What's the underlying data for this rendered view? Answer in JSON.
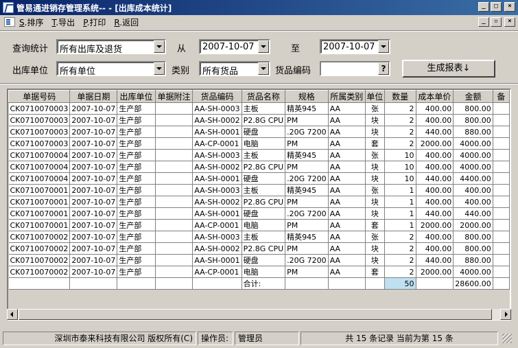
{
  "window": {
    "title": "管易通进销存管理系统-- - [出库成本统计]"
  },
  "menu": [
    {
      "key": "S",
      "label": ".排序"
    },
    {
      "key": "T",
      "label": ".导出"
    },
    {
      "key": "P",
      "label": ".打印"
    },
    {
      "key": "R",
      "label": ".返回"
    }
  ],
  "filters": {
    "query_label": "查询统计",
    "query_value": "所有出库及退货",
    "from_label": "从",
    "from_value": "2007-10-07",
    "to_label": "至",
    "to_value": "2007-10-07",
    "dept_label": "出库单位",
    "dept_value": "所有单位",
    "category_label": "类别",
    "category_value": "所有货品",
    "code_label": "货品编码",
    "code_value": "",
    "code_button": "?",
    "generate_label": "生成报表↓"
  },
  "table": {
    "columns": [
      "单据号码",
      "单据日期",
      "出库单位",
      "单据附注",
      "货品编码",
      "货品名称",
      "规格",
      "所属类别",
      "单位",
      "数量",
      "成本单价",
      "金额",
      "备"
    ],
    "rows": [
      [
        "CK0710070003",
        "2007-10-07",
        "生产部",
        "",
        "AA-SH-0003",
        "主板",
        "精英945",
        "AA",
        "张",
        "2",
        "400.00",
        "800.00"
      ],
      [
        "CK0710070003",
        "2007-10-07",
        "生产部",
        "",
        "AA-SH-0002",
        "P2.8G CPU",
        "PM",
        "AA",
        "块",
        "2",
        "400.00",
        "800.00"
      ],
      [
        "CK0710070003",
        "2007-10-07",
        "生产部",
        "",
        "AA-SH-0001",
        "硬盘",
        ".20G 7200",
        "AA",
        "块",
        "2",
        "440.00",
        "880.00"
      ],
      [
        "CK0710070003",
        "2007-10-07",
        "生产部",
        "",
        "AA-CP-0001",
        "电脑",
        "PM",
        "AA",
        "套",
        "2",
        "2000.00",
        "4000.00"
      ],
      [
        "CK0710070004",
        "2007-10-07",
        "生产部",
        "",
        "AA-SH-0003",
        "主板",
        "精英945",
        "AA",
        "张",
        "10",
        "400.00",
        "4000.00"
      ],
      [
        "CK0710070004",
        "2007-10-07",
        "生产部",
        "",
        "AA-SH-0002",
        "P2.8G CPU",
        "PM",
        "AA",
        "块",
        "10",
        "400.00",
        "4000.00"
      ],
      [
        "CK0710070004",
        "2007-10-07",
        "生产部",
        "",
        "AA-SH-0001",
        "硬盘",
        ".20G 7200",
        "AA",
        "块",
        "10",
        "440.00",
        "4400.00"
      ],
      [
        "CK0710070001",
        "2007-10-07",
        "生产部",
        "",
        "AA-SH-0003",
        "主板",
        "精英945",
        "AA",
        "张",
        "1",
        "400.00",
        "400.00"
      ],
      [
        "CK0710070001",
        "2007-10-07",
        "生产部",
        "",
        "AA-SH-0002",
        "P2.8G CPU",
        "PM",
        "AA",
        "块",
        "1",
        "400.00",
        "400.00"
      ],
      [
        "CK0710070001",
        "2007-10-07",
        "生产部",
        "",
        "AA-SH-0001",
        "硬盘",
        ".20G 7200",
        "AA",
        "块",
        "1",
        "440.00",
        "440.00"
      ],
      [
        "CK0710070001",
        "2007-10-07",
        "生产部",
        "",
        "AA-CP-0001",
        "电脑",
        "PM",
        "AA",
        "套",
        "1",
        "2000.00",
        "2000.00"
      ],
      [
        "CK0710070002",
        "2007-10-07",
        "生产部",
        "",
        "AA-SH-0003",
        "主板",
        "精英945",
        "AA",
        "张",
        "2",
        "400.00",
        "800.00"
      ],
      [
        "CK0710070002",
        "2007-10-07",
        "生产部",
        "",
        "AA-SH-0002",
        "P2.8G CPU",
        "PM",
        "AA",
        "块",
        "2",
        "400.00",
        "800.00"
      ],
      [
        "CK0710070002",
        "2007-10-07",
        "生产部",
        "",
        "AA-SH-0001",
        "硬盘",
        ".20G 7200",
        "AA",
        "块",
        "2",
        "440.00",
        "880.00"
      ],
      [
        "CK0710070002",
        "2007-10-07",
        "生产部",
        "",
        "AA-CP-0001",
        "电脑",
        "PM",
        "AA",
        "套",
        "2",
        "2000.00",
        "4000.00"
      ]
    ],
    "total": {
      "label": "合计:",
      "quantity": "50",
      "amount": "28600.00"
    }
  },
  "status": {
    "company": "深圳市泰来科技有限公司 版权所有(C)",
    "operator_label": "操作员:",
    "operator": "管理员",
    "records": "共 15 条记录 当前为第 15 条"
  }
}
